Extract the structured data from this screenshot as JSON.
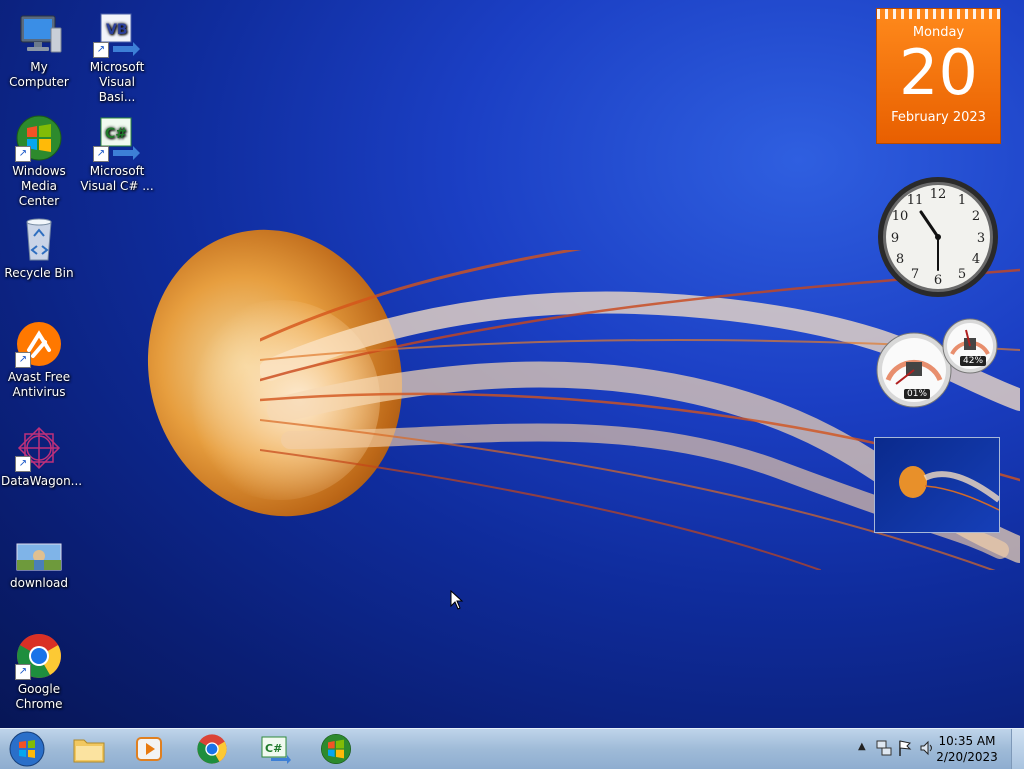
{
  "desktop_icons": [
    {
      "label_line1": "My Computer",
      "label_line2": "",
      "icon": "my-computer-icon"
    },
    {
      "label_line1": "Microsoft",
      "label_line2": "Visual Basi...",
      "icon": "visual-basic-icon"
    },
    {
      "label_line1": "Windows",
      "label_line2": "Media Center",
      "icon": "windows-media-center-icon"
    },
    {
      "label_line1": "Microsoft",
      "label_line2": "Visual C# ...",
      "icon": "visual-csharp-icon"
    },
    {
      "label_line1": "Recycle Bin",
      "label_line2": "",
      "icon": "recycle-bin-icon"
    },
    {
      "label_line1": "Avast Free",
      "label_line2": "Antivirus",
      "icon": "avast-icon"
    },
    {
      "label_line1": "DataWagon...",
      "label_line2": "",
      "icon": "datawagon-icon"
    },
    {
      "label_line1": "download",
      "label_line2": "",
      "icon": "image-file-icon"
    },
    {
      "label_line1": "Google",
      "label_line2": "Chrome",
      "icon": "chrome-icon"
    }
  ],
  "calendar_gadget": {
    "weekday": "Monday",
    "day": "20",
    "month_year": "February 2023"
  },
  "cpu_meter": {
    "cpu_percent": "01%",
    "memory_percent": "42%"
  },
  "taskbar": {
    "pinned": [
      "start-orb-icon",
      "explorer-folder-icon",
      "media-player-icon",
      "chrome-icon",
      "visual-csharp-icon",
      "windows-media-center-icon"
    ],
    "time": "10:35 AM",
    "date": "2/20/2023",
    "tray_icons": [
      "show-hidden-icons-chevron-icon",
      "network-icon",
      "action-center-flag-icon",
      "volume-icon"
    ]
  },
  "colors": {
    "calendar_orange": "#f47a12",
    "taskbar": "#a9c3df",
    "desktop_blue": "#1b3fc4"
  }
}
